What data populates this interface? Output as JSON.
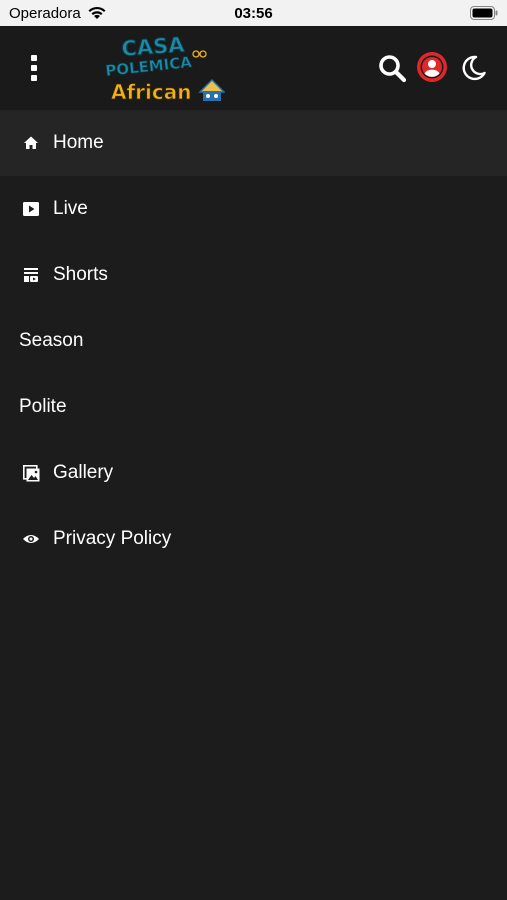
{
  "status_bar": {
    "carrier": "Operadora",
    "time": "03:56"
  },
  "header": {
    "logo_alt": "Casa Polemica African",
    "logo_line1": "CASA",
    "logo_line2": "POLEMICA",
    "logo_line3": "African",
    "icons": [
      "menu-dots-icon",
      "search-icon",
      "account-icon",
      "moon-icon"
    ],
    "accent_color": "#e0272a"
  },
  "menu": {
    "items": [
      {
        "label": "Home",
        "icon": "home-icon",
        "active": true
      },
      {
        "label": "Live",
        "icon": "play-icon"
      },
      {
        "label": "Shorts",
        "icon": "shorts-icon"
      },
      {
        "label": "Season",
        "icon": null
      },
      {
        "label": "Polite",
        "icon": null
      },
      {
        "label": "Gallery",
        "icon": "gallery-icon"
      },
      {
        "label": "Privacy Policy",
        "icon": "eye-icon"
      }
    ]
  }
}
